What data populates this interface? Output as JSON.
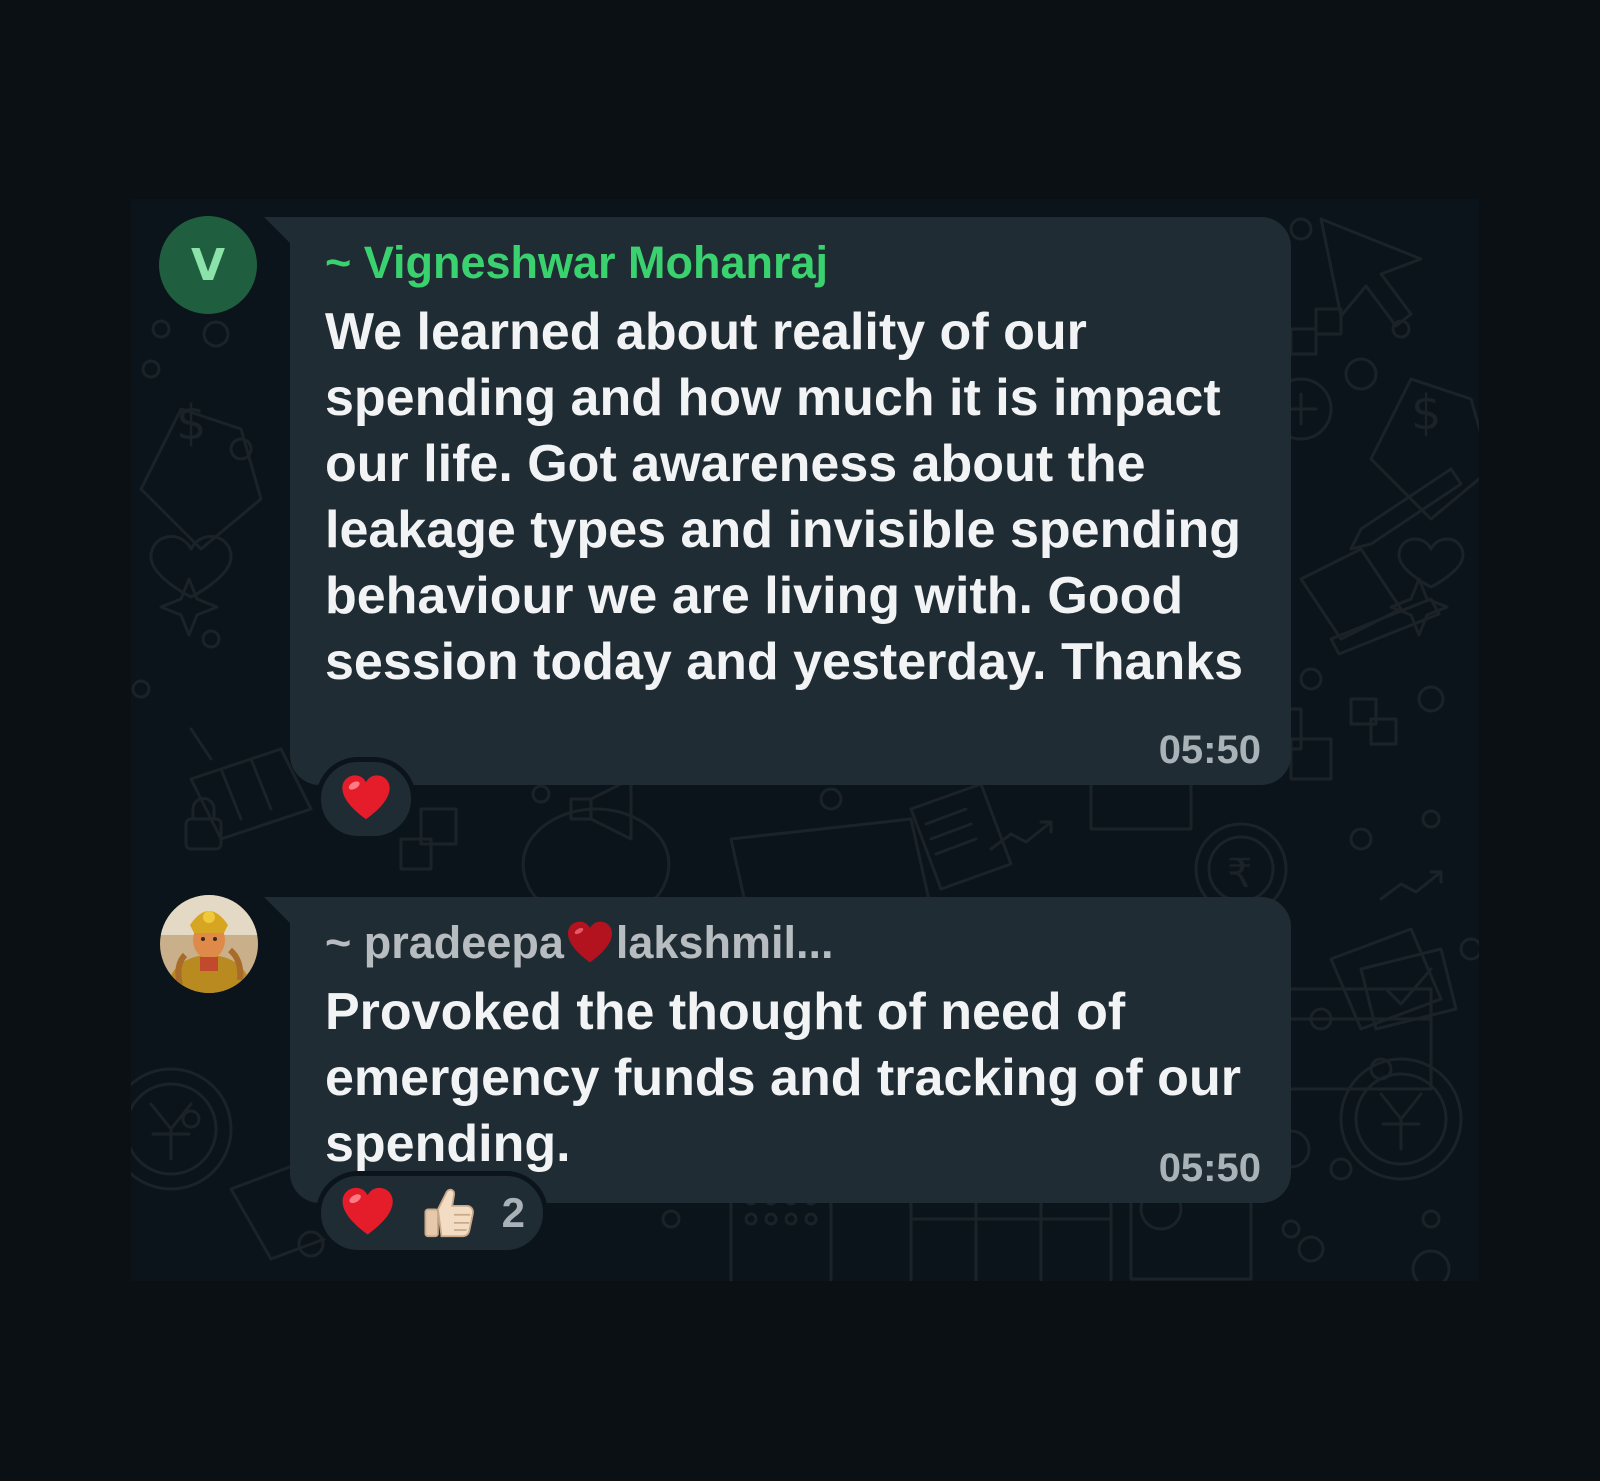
{
  "messages": [
    {
      "avatar_initial": "V",
      "sender": "~ Vigneshwar Mohanraj",
      "text": "We learned about reality of our spending and how much it is impact our life. Got awareness about the leakage types and invisible spending behaviour we are living with. Good session today and yesterday. Thanks",
      "time": "05:50",
      "reactions": [
        "heart"
      ],
      "sender_color": "#3ad16f"
    },
    {
      "sender_prefix": "~ pradeepa",
      "sender_suffix": "lakshmil...",
      "text": "Provoked the thought of need of emergency funds and tracking of our spending.",
      "time": "05:50",
      "reactions": [
        "heart",
        "thumbs-up"
      ],
      "reaction_count": "2",
      "sender_color": "#b6bcc0"
    }
  ],
  "colors": {
    "background": "#0b1014",
    "bubble": "#202c33",
    "avatar_bg": "#1f5f3f"
  }
}
